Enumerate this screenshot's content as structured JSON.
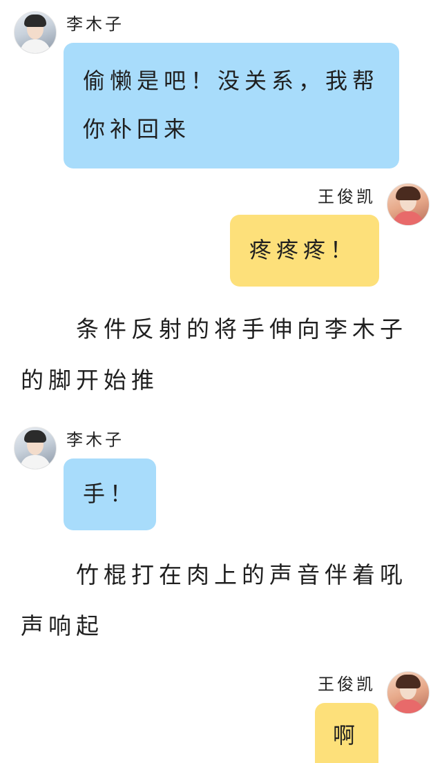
{
  "colors": {
    "left_bubble": "#a8dcfb",
    "right_bubble": "#fde07a",
    "background": "#ffffff"
  },
  "messages": [
    {
      "sender": "李木子",
      "side": "left",
      "text": "偷懒是吧！没关系，我帮你补回来",
      "avatar": "avatar-photo"
    },
    {
      "sender": "王俊凯",
      "side": "right",
      "text": "疼疼疼！",
      "avatar": "avatar-photo"
    },
    {
      "sender": "李木子",
      "side": "left",
      "text": "手！",
      "avatar": "avatar-photo"
    },
    {
      "sender": "王俊凯",
      "side": "right",
      "text": "啊",
      "avatar": "avatar-photo"
    }
  ],
  "narrations": [
    "条件反射的将手伸向李木子的脚开始推",
    "竹棍打在肉上的声音伴着吼声响起"
  ]
}
